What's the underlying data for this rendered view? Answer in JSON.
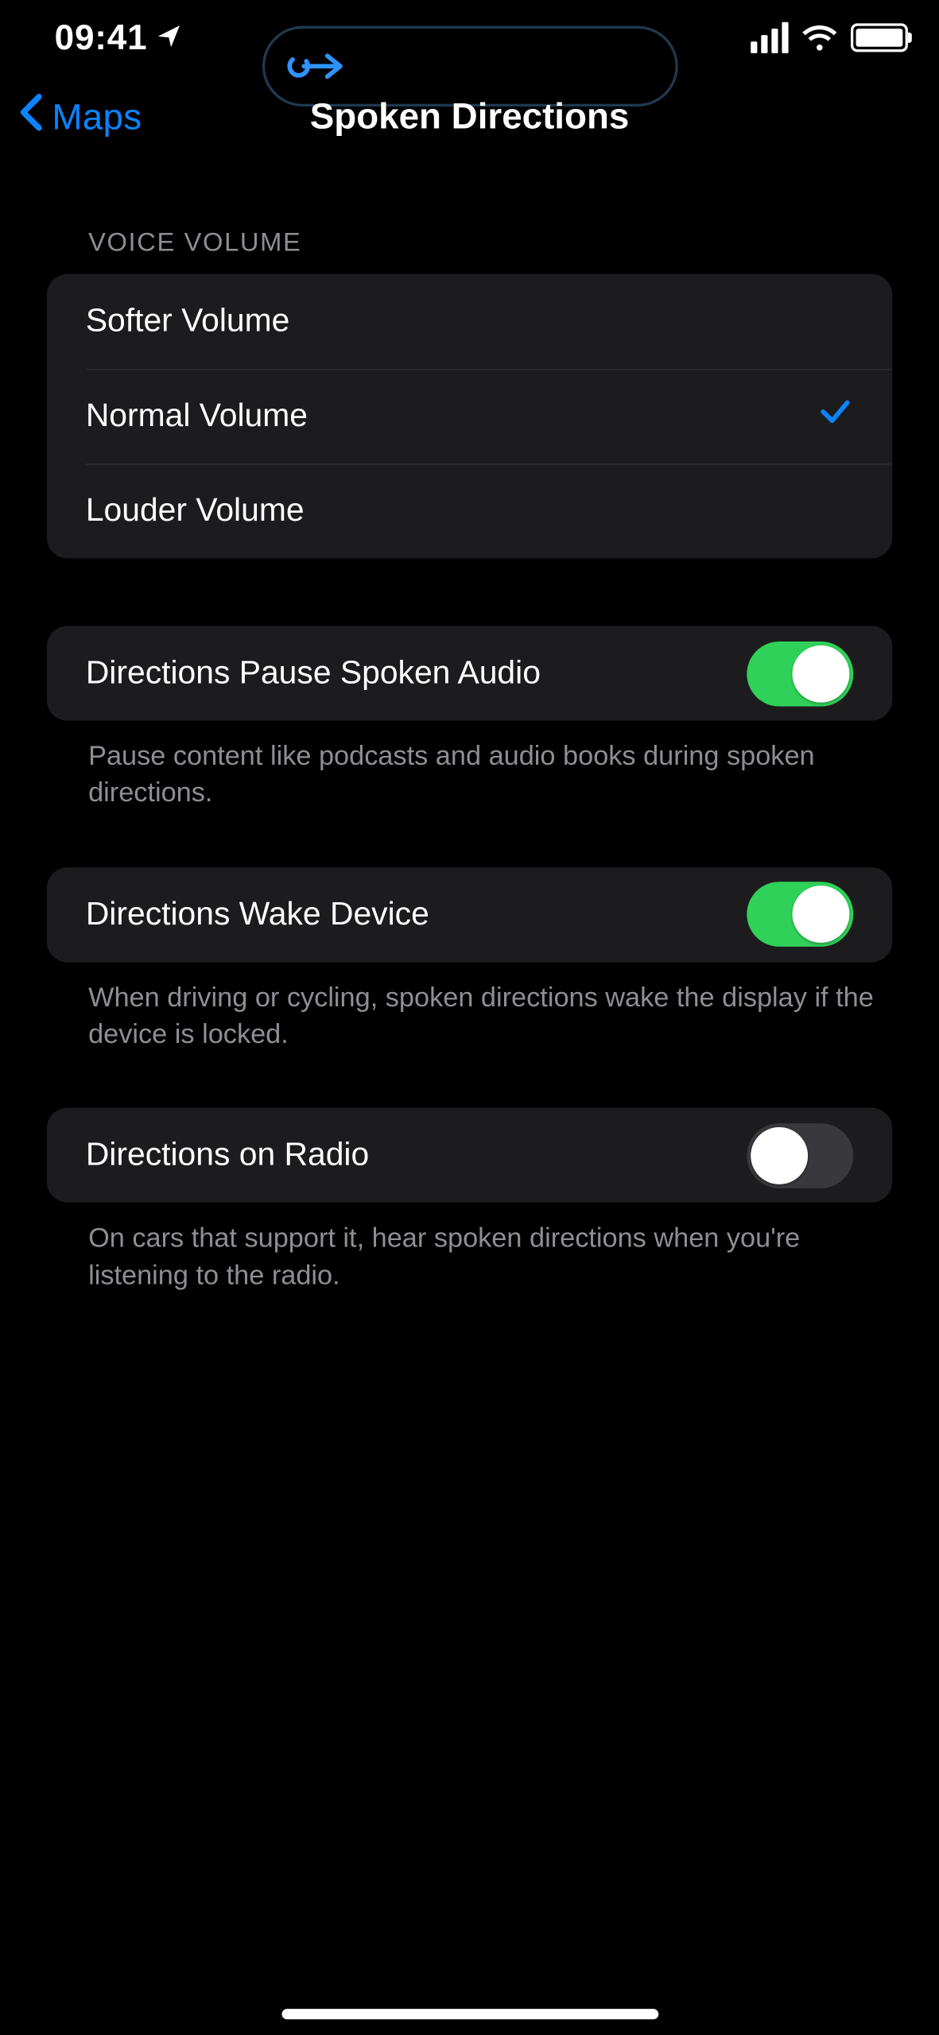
{
  "status": {
    "time": "09:41"
  },
  "nav": {
    "back_label": "Maps",
    "title": "Spoken Directions"
  },
  "voice_volume": {
    "header": "VOICE VOLUME",
    "options": [
      {
        "label": "Softer Volume",
        "selected": false
      },
      {
        "label": "Normal Volume",
        "selected": true
      },
      {
        "label": "Louder Volume",
        "selected": false
      }
    ]
  },
  "toggles": {
    "pause_audio": {
      "label": "Directions Pause Spoken Audio",
      "on": true,
      "footer": "Pause content like podcasts and audio books during spoken directions."
    },
    "wake_device": {
      "label": "Directions Wake Device",
      "on": true,
      "footer": "When driving or cycling, spoken directions wake the display if the device is locked."
    },
    "on_radio": {
      "label": "Directions on Radio",
      "on": false,
      "footer": "On cars that support it, hear spoken directions when you're listening to the radio."
    }
  }
}
